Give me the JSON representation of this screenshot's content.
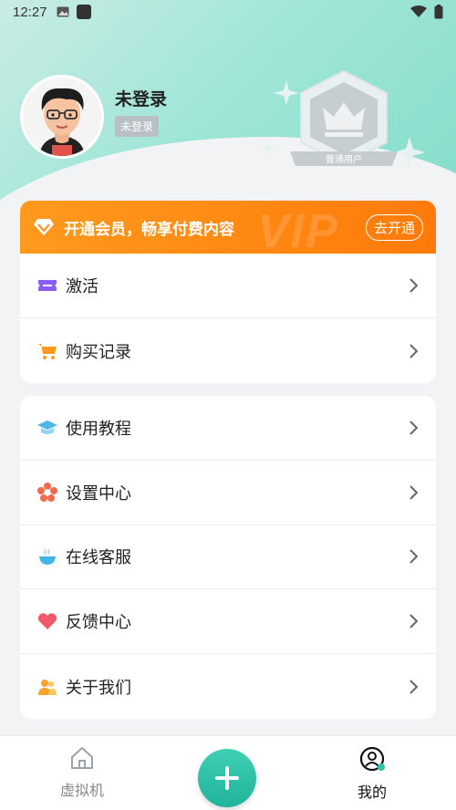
{
  "status_bar": {
    "time": "12:27"
  },
  "profile": {
    "name": "未登录",
    "badge": "未登录",
    "level_label": "普通用户"
  },
  "vip": {
    "title": "开通会员，畅享付费内容",
    "watermark": "VIP",
    "button": "去开通",
    "color": "#ff8a14"
  },
  "menu_group_1": [
    {
      "label": "激活",
      "icon": "ticket-icon"
    },
    {
      "label": "购买记录",
      "icon": "cart-icon"
    }
  ],
  "menu_group_2": [
    {
      "label": "使用教程",
      "icon": "graduation-cap-icon"
    },
    {
      "label": "设置中心",
      "icon": "flower-settings-icon"
    },
    {
      "label": "在线客服",
      "icon": "bowl-service-icon"
    },
    {
      "label": "反馈中心",
      "icon": "heart-icon"
    },
    {
      "label": "关于我们",
      "icon": "users-icon"
    }
  ],
  "tabbar": {
    "home_label": "虚拟机",
    "mine_label": "我的",
    "accent": "#1fb39a"
  }
}
